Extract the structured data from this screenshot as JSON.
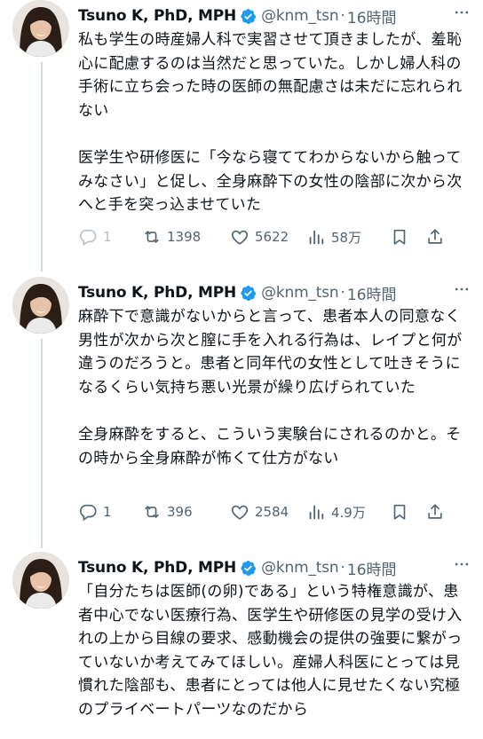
{
  "author": {
    "name": "Tsuno K, PhD, MPH",
    "handle": "@knm_tsn",
    "separator": "·"
  },
  "colors": {
    "text": "#0f1419",
    "secondary": "#536471",
    "verified": "#1d9bf0",
    "thread_line": "#cfd9de"
  },
  "tweets": [
    {
      "time": "16時間",
      "text": "私も学生の時産婦人科で実習させて頂きましたが、羞恥心に配慮するのは当然だと思っていた。しかし婦人科の手術に立ち会った時の医師の無配慮さは未だに忘れられない\n\n医学生や研修医に「今なら寝ててわからないから触ってみなさい」と促し、全身麻酔下の女性の陰部に次から次へと手を突っ込ませていた",
      "replies": "1",
      "retweets": "1398",
      "likes": "5622",
      "views": "58万"
    },
    {
      "time": "16時間",
      "text": "麻酔下で意識がないからと言って、患者本人の同意なく男性が次から次と膣に手を入れる行為は、レイプと何が違うのだろうと。患者と同年代の女性として吐きそうになるくらい気持ち悪い光景が繰り広げられていた\n\n全身麻酔をすると、こういう実験台にされるのかと。その時から全身麻酔が怖くて仕方がない",
      "replies": "1",
      "retweets": "396",
      "likes": "2584",
      "views": "4.9万"
    },
    {
      "time": "16時間",
      "text": "「自分たちは医師(の卵)である」という特権意識が、患者中心でない医療行為、医学生や研修医の見学の受け入れの上から目線の要求、感動機会の提供の強要に繋がっていないか考えてみてほしい。産婦人科医にとっては見慣れた陰部も、患者にとっては他人に見せたくない究極のプライベートパーツなのだから"
    }
  ],
  "icons": {
    "verified": "verified-badge-icon",
    "more": "more-options-icon",
    "reply": "reply-icon",
    "retweet": "retweet-icon",
    "like": "like-icon",
    "views": "views-icon",
    "bookmark": "bookmark-icon",
    "share": "share-icon"
  }
}
